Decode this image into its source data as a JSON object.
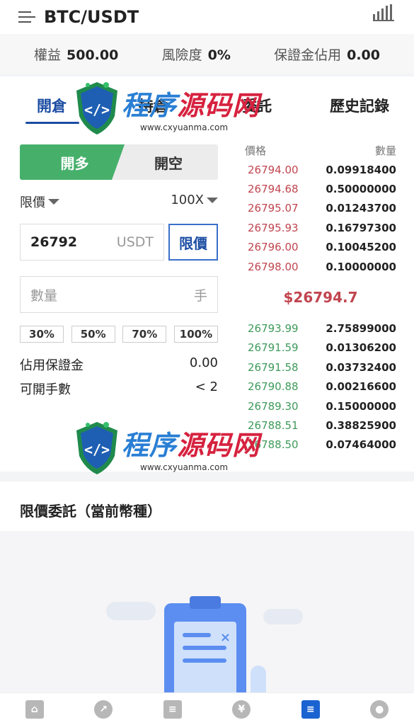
{
  "header": {
    "title": "BTC/USDT"
  },
  "stats": [
    {
      "label": "權益",
      "value": "500.00"
    },
    {
      "label": "風險度",
      "value": "0%"
    },
    {
      "label": "保證金佔用",
      "value": "0.00"
    }
  ],
  "tabs": [
    {
      "label": "開倉"
    },
    {
      "label": "持倉"
    },
    {
      "label": "委託"
    },
    {
      "label": "歷史記錄"
    }
  ],
  "trade": {
    "long_label": "開多",
    "short_label": "開空",
    "order_type": "限價",
    "leverage": "100X",
    "price_value": "26792",
    "price_unit": "USDT",
    "limit_button": "限價",
    "qty_placeholder": "數量",
    "qty_unit": "手",
    "percents": [
      "30%",
      "50%",
      "70%",
      "100%"
    ],
    "margin_label": "佔用保證金",
    "margin_value": "0.00",
    "openable_label": "可開手數",
    "openable_value": "< 2"
  },
  "orderbook": {
    "price_header": "價格",
    "qty_header": "數量",
    "asks": [
      {
        "price": "26794.00",
        "qty": "0.09918400"
      },
      {
        "price": "26794.68",
        "qty": "0.50000000"
      },
      {
        "price": "26795.07",
        "qty": "0.01243700"
      },
      {
        "price": "26795.93",
        "qty": "0.16797300"
      },
      {
        "price": "26796.00",
        "qty": "0.10045200"
      },
      {
        "price": "26798.00",
        "qty": "0.10000000"
      }
    ],
    "last_price": "$26794.7",
    "bids": [
      {
        "price": "26793.99",
        "qty": "2.75899000"
      },
      {
        "price": "26791.59",
        "qty": "0.01306200"
      },
      {
        "price": "26791.58",
        "qty": "0.03732400"
      },
      {
        "price": "26790.88",
        "qty": "0.00216600"
      },
      {
        "price": "26789.30",
        "qty": "0.15000000"
      },
      {
        "price": "26788.51",
        "qty": "0.38825900"
      },
      {
        "price": "26788.50",
        "qty": "0.07464000"
      }
    ]
  },
  "orders": {
    "title": "限價委託（當前幣種）"
  },
  "watermark": {
    "main_a": "程序",
    "main_b": "源码网",
    "sub": "www.cxyuanma.com"
  },
  "nav": [
    {
      "icon": "home-icon",
      "glyph": "⌂"
    },
    {
      "icon": "market-icon",
      "glyph": "↗"
    },
    {
      "icon": "news-icon",
      "glyph": "≡"
    },
    {
      "icon": "finance-icon",
      "glyph": "¥"
    },
    {
      "icon": "trade-icon",
      "glyph": "≡"
    },
    {
      "icon": "user-icon",
      "glyph": "●"
    }
  ],
  "colors": {
    "accent": "#1b4da3",
    "buy": "#46b06b",
    "ask": "#c0454f",
    "bid": "#3f9a5b",
    "nav_active": "#1b63d1"
  }
}
